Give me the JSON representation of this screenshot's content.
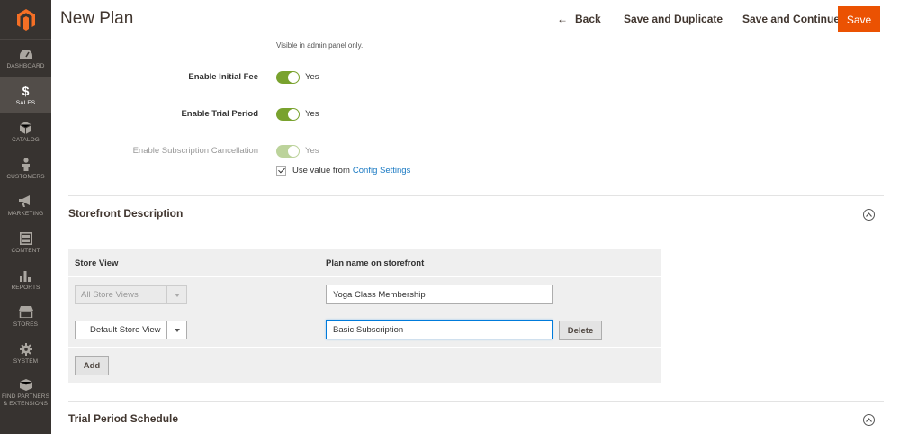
{
  "sidebar": {
    "items": [
      {
        "label": "DASHBOARD",
        "icon": "dashboard-icon"
      },
      {
        "label": "SALES",
        "icon": "dollar-icon",
        "active": true
      },
      {
        "label": "CATALOG",
        "icon": "cube-icon"
      },
      {
        "label": "CUSTOMERS",
        "icon": "person-icon"
      },
      {
        "label": "MARKETING",
        "icon": "megaphone-icon"
      },
      {
        "label": "CONTENT",
        "icon": "layout-icon"
      },
      {
        "label": "REPORTS",
        "icon": "bar-chart-icon"
      },
      {
        "label": "STORES",
        "icon": "storefront-icon"
      },
      {
        "label": "SYSTEM",
        "icon": "gear-icon"
      },
      {
        "label": "FIND PARTNERS & EXTENSIONS",
        "icon": "box-icon"
      }
    ]
  },
  "header": {
    "title": "New Plan",
    "back_label": "Back",
    "save_duplicate_label": "Save and Duplicate",
    "save_continue_label": "Save and Continue",
    "save_label": "Save"
  },
  "form": {
    "hint": "Visible in admin panel only.",
    "initial_fee": {
      "label": "Enable Initial Fee",
      "value": "Yes"
    },
    "trial_period": {
      "label": "Enable Trial Period",
      "value": "Yes"
    },
    "cancellation": {
      "label": "Enable Subscription Cancellation",
      "value": "Yes"
    },
    "use_config": {
      "text": "Use value from",
      "link": "Config Settings"
    }
  },
  "storefront": {
    "title": "Storefront Description",
    "col_store_view": "Store View",
    "col_plan_name": "Plan name on storefront",
    "rows": [
      {
        "store_view": "All Store Views",
        "plan_name": "Yoga Class Membership"
      },
      {
        "store_view": "Default Store View",
        "plan_name": "Basic Subscription",
        "delete_label": "Delete"
      }
    ],
    "add_label": "Add"
  },
  "trial_schedule": {
    "title": "Trial Period Schedule"
  },
  "colors": {
    "accent": "#eb5202",
    "toggle": "#79a22e",
    "link": "#1979c3",
    "sidebar": "#373330"
  }
}
